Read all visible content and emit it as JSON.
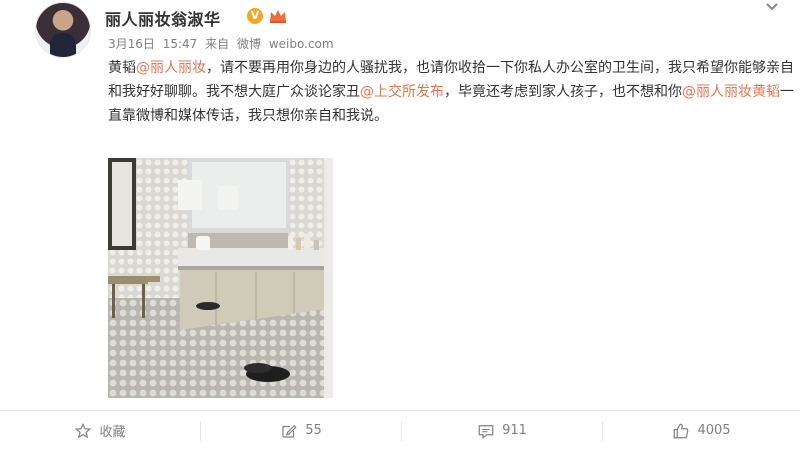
{
  "post": {
    "username": "丽人丽妆翁淑华",
    "verified_mark": "V",
    "date": "3月16日",
    "time": "15:47",
    "source_prefix": "来自",
    "source": "微博",
    "source_domain": "weibo.com",
    "text": {
      "seg1": "黄韬",
      "mention1": "@丽人丽妆",
      "seg2": "，请不要再用你身边的人骚扰我，也请你收拾一下你私人办公室的卫生间，我只希望你能够亲自和我好好聊聊。我不想大庭广众谈论家丑",
      "mention2": "@上交所发布",
      "seg3": "，毕竟还考虑到家人孩子，也不想和你",
      "mention3": "@丽人丽妆黄韬",
      "seg4": "一直靠微博和媒体传话，我只想你亲自和我说。"
    }
  },
  "actions": {
    "favorite": {
      "label": "收藏"
    },
    "repost": {
      "count": "55"
    },
    "comment": {
      "count": "911"
    },
    "like": {
      "count": "4005"
    }
  },
  "colors": {
    "mention": "#eb7350",
    "meta": "#808080",
    "text": "#333333"
  },
  "icons": [
    "chevron-down-icon",
    "verified-badge-icon",
    "member-crown-icon",
    "star-icon",
    "edit-icon",
    "comment-icon",
    "thumbs-up-icon"
  ]
}
